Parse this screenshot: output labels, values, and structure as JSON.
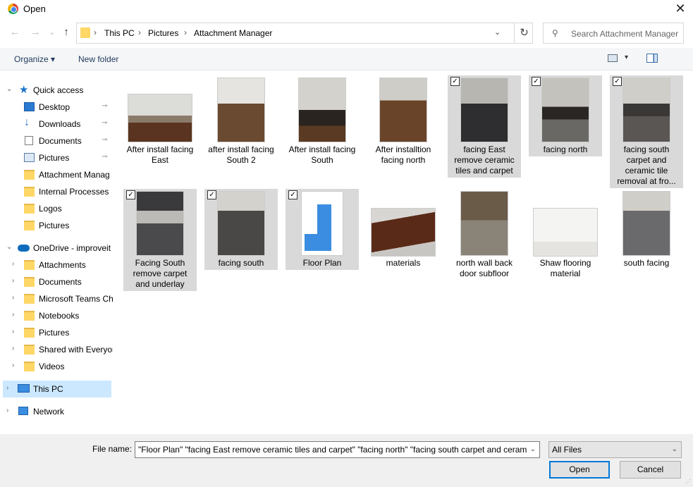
{
  "window": {
    "title": "Open",
    "close_glyph": "✕"
  },
  "nav": {
    "back_glyph": "←",
    "forward_glyph": "→",
    "recent_glyph": "⌄",
    "up_glyph": "↑",
    "breadcrumb": [
      "This PC",
      "Pictures",
      "Attachment Manager"
    ],
    "sep": "›",
    "refresh_glyph": "↻",
    "dropdown_glyph": "⌄",
    "search_placeholder": "Search Attachment Manager",
    "search_icon": "⚲"
  },
  "toolbar": {
    "organize": "Organize ▾",
    "new_folder": "New folder",
    "views_dd": "▾",
    "help": "?"
  },
  "sidebar": {
    "quick_access": "Quick access",
    "quick_items": [
      "Desktop",
      "Downloads",
      "Documents",
      "Pictures",
      "Attachment Manag",
      "Internal Processes",
      "Logos",
      "Pictures"
    ],
    "onedrive": "OneDrive - improveit",
    "onedrive_items": [
      "Attachments",
      "Documents",
      "Microsoft Teams Ch",
      "Notebooks",
      "Pictures",
      "Shared with Everyor",
      "Videos"
    ],
    "this_pc": "This PC",
    "network": "Network",
    "pin_glyph": "📌",
    "chev_open": "⌄",
    "chev_closed": "›"
  },
  "files": [
    {
      "name": "After install facing East",
      "selected": false
    },
    {
      "name": "after install facing South 2",
      "selected": false
    },
    {
      "name": "After install facing South",
      "selected": false
    },
    {
      "name": "After installtion facing north",
      "selected": false
    },
    {
      "name": "facing East remove ceramic tiles and carpet",
      "selected": true
    },
    {
      "name": "facing north",
      "selected": true
    },
    {
      "name": "facing south carpet and ceramic tile removal at fro...",
      "selected": true
    },
    {
      "name": "Facing South remove carpet and underlay",
      "selected": true
    },
    {
      "name": "facing south",
      "selected": true
    },
    {
      "name": "Floor Plan",
      "selected": true
    },
    {
      "name": "materials",
      "selected": false
    },
    {
      "name": "north wall back door subfloor",
      "selected": false
    },
    {
      "name": "Shaw flooring material",
      "selected": false
    },
    {
      "name": "south facing",
      "selected": false
    }
  ],
  "footer": {
    "file_name_label": "File name:",
    "file_name_value": "\"Floor Plan\" \"facing East remove ceramic tiles and carpet\" \"facing north\" \"facing south carpet and ceram",
    "file_type": "All Files",
    "open": "Open",
    "cancel": "Cancel",
    "dd_glyph": "⌄",
    "check_glyph": "✓"
  }
}
